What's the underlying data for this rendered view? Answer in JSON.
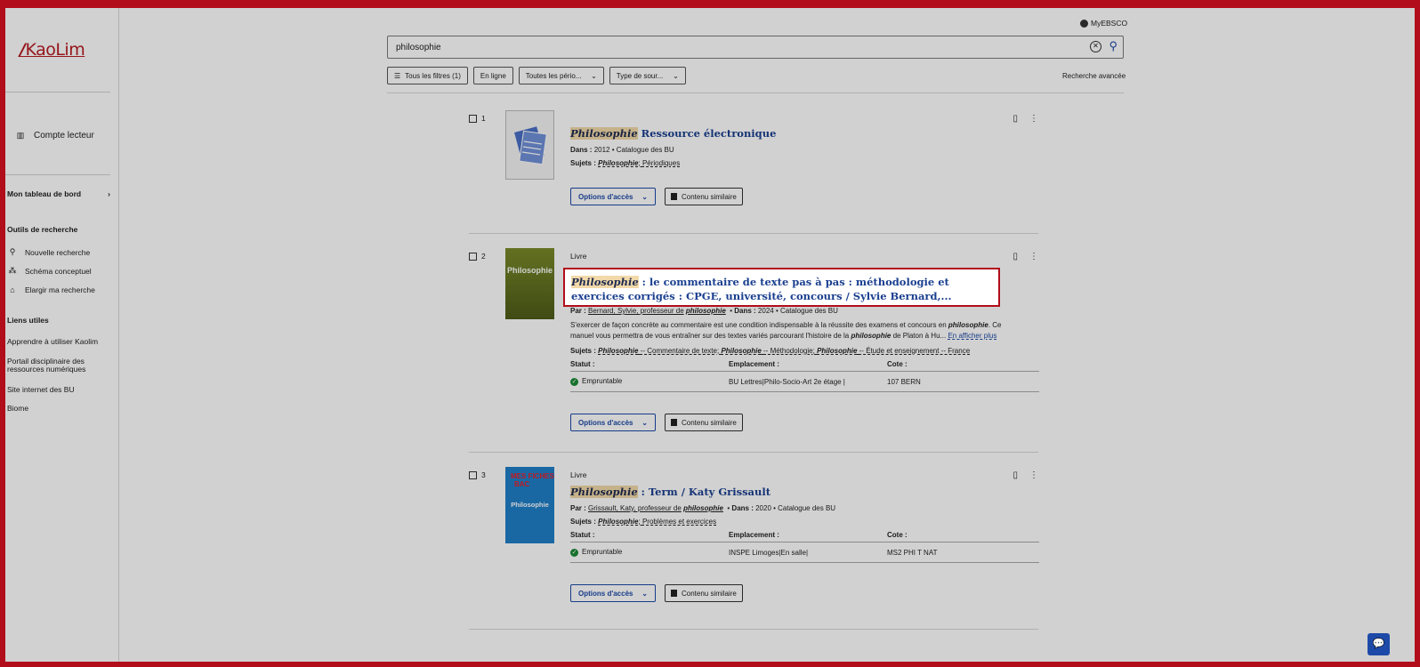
{
  "brand": {
    "logo": "KaoLim",
    "color": "#b81b23"
  },
  "header": {
    "myebsco": "MyEBSCO",
    "advanced": "Recherche avancée"
  },
  "search": {
    "value": "philosophie"
  },
  "filters": [
    "Tous les filtres (1)",
    "En ligne",
    "Toutes les pério...",
    "Type de sour..."
  ],
  "sidebar": {
    "account": "Compte lecteur",
    "dashboard": "Mon tableau de bord",
    "tools_head": "Outils de recherche",
    "tools": [
      "Nouvelle recherche",
      "Schéma conceptuel",
      "Elargir ma recherche"
    ],
    "links_head": "Liens utiles",
    "links": [
      "Apprendre à utiliser Kaolim",
      "Portail disciplinaire des ressources numériques",
      "Site internet des BU",
      "Biome"
    ]
  },
  "labels": {
    "access": "Options d'accès",
    "similar": "Contenu similaire",
    "status": "Statut :",
    "location": "Emplacement :",
    "call": "Cote :",
    "more": "En afficher plus",
    "in": "Dans :",
    "by": "Par :",
    "subjects": "Sujets :"
  },
  "results": [
    {
      "num": "1",
      "type": "",
      "title_hl": "Philosophie",
      "title_rest": " Ressource électronique",
      "dans": "2012 • Catalogue des BU",
      "subjects": "Périodiques",
      "subjects_hl": "Philosophie"
    },
    {
      "num": "2",
      "type": "Livre",
      "title_hl": "Philosophie",
      "title_rest": " : le commentaire de texte pas à pas : méthodologie et exercices corrigés : CPGE, université, concours / Sylvie Bernard,...",
      "par": "Bernard, Sylvie, professeur de",
      "par_hl": "philosophie",
      "dans": "2024 • Catalogue des BU",
      "desc_a": "S'exercer de façon concrète au commentaire est une condition indispensable à la réussite des examens et concours en",
      "desc_b": ". Ce manuel vous permettra de vous entraîner sur des textes variés parcourant l'histoire de la",
      "desc_c": "de Platon à Hu...",
      "desc_hl": "philosophie",
      "subjects_hl": "Philosophie",
      "subjects_a": "-- Commentaire de texte;",
      "subjects_b": "-- Méthodologie;",
      "subjects_c": "-- Étude et enseignement -- France",
      "status": "Empruntable",
      "location": "BU Lettres|Philo-Socio-Art 2e étage |",
      "call": "107 BERN"
    },
    {
      "num": "3",
      "type": "Livre",
      "title_hl": "Philosophie",
      "title_rest": " : Term / Katy Grissault",
      "par": "Grissault, Katy, professeur de",
      "par_hl": "philosophie",
      "dans": "2020 • Catalogue des BU",
      "subjects_hl": "Philosophie",
      "subjects": "Problèmes et exercices",
      "status": "Empruntable",
      "location": "INSPE Limoges|En salle|",
      "call": "MS2 PHI T NAT",
      "cover_top": "MES FICHES",
      "cover_bac": "BAC",
      "cover_title": "Philosophie"
    }
  ]
}
